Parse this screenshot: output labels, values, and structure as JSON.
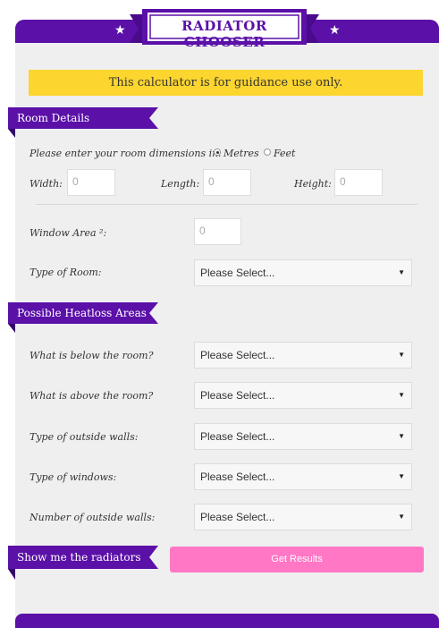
{
  "header": {
    "title": "RADIATOR CHOOSER"
  },
  "notice": "This calculator is for guidance use only.",
  "room_details": {
    "heading": "Room Details",
    "units_prompt": "Please enter your room dimensions in:",
    "units_options": [
      "Metres",
      "Feet"
    ],
    "units_selected": "Metres",
    "width_label": "Width:",
    "width_value": "0",
    "length_label": "Length:",
    "length_value": "0",
    "height_label": "Height:",
    "height_value": "0",
    "window_label": "Window Area ²:",
    "window_value": "0",
    "room_type_label": "Type of Room:",
    "room_type_value": "Please Select..."
  },
  "heatloss": {
    "heading": "Possible Heatloss Areas",
    "rows": [
      {
        "label": "What is below the room?",
        "value": "Please Select..."
      },
      {
        "label": "What is above the room?",
        "value": "Please Select..."
      },
      {
        "label": "Type of outside walls:",
        "value": "Please Select..."
      },
      {
        "label": "Type of windows:",
        "value": "Please Select..."
      },
      {
        "label": "Number of outside walls:",
        "value": "Please Select..."
      }
    ]
  },
  "results": {
    "heading": "Show me the radiators",
    "button_label": "Get Results"
  },
  "colors": {
    "purple": "#5b10a8",
    "notice_yellow": "#fcd52e",
    "button_pink": "#ff77c5"
  }
}
